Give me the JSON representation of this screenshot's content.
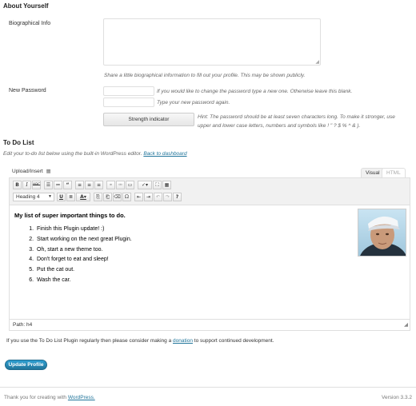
{
  "about": {
    "heading": "About Yourself",
    "bio_label": "Biographical Info",
    "bio_value": "",
    "bio_desc": "Share a little biographical information to fill out your profile. This may be shown publicly.",
    "password_label": "New Password",
    "password_hint1": "If you would like to change the password type a new one. Otherwise leave this blank.",
    "password_hint2": "Type your new password again.",
    "strength_label": "Strength indicator",
    "strength_hint": "Hint: The password should be at least seven characters long. To make it stronger, use upper and lower case letters, numbers and symbols like ! \" ? $ % ^ & )."
  },
  "todo": {
    "heading": "To Do List",
    "intro": "Edit your to-do list below using the built-in WordPress editor.",
    "dashboard_link": "Back to dashboard",
    "upload_label": "Upload/Insert",
    "tab_visual": "Visual",
    "tab_html": "HTML",
    "format_select": "Heading 4",
    "content_heading": "My list of super important things to do.",
    "items": [
      "Finish this Plugin update! :)",
      "Start working on the next great Plugin.",
      "Oh, start a new theme too.",
      "Don't forget to eat and sleep!",
      "Put the cat out.",
      "Wash the car."
    ],
    "path_label": "Path:",
    "path_value": "h4",
    "donate_before": "If you use the To Do List Plugin regularly then please consider making a",
    "donate_link": "donation",
    "donate_after": "to support continued development."
  },
  "update_button": "Update Profile",
  "footer": {
    "thanks": "Thank you for creating with",
    "wp_link": "WordPress.",
    "version": "Version 3.3.2"
  },
  "colors": {
    "link": "#21759b",
    "primary": "#21759b"
  }
}
